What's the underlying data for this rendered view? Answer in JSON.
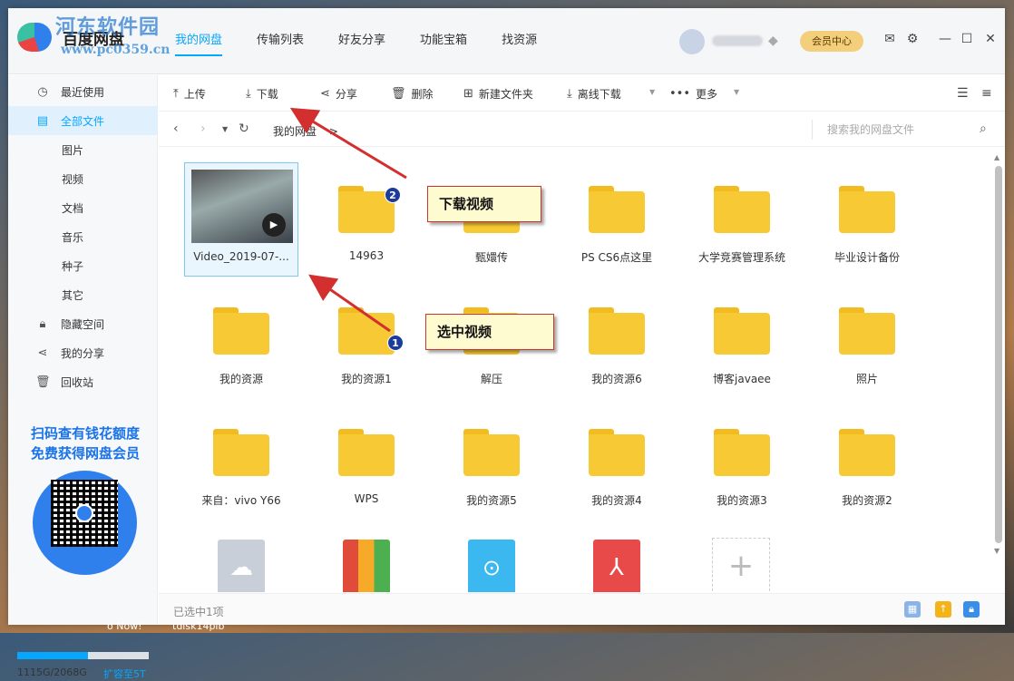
{
  "watermark": {
    "title": "河东软件园",
    "url": "www.pc0359.cn"
  },
  "header": {
    "app_name": "百度网盘",
    "nav": [
      "我的网盘",
      "传输列表",
      "好友分享",
      "功能宝箱",
      "找资源"
    ],
    "member_center": "会员中心"
  },
  "sidebar": {
    "items": [
      {
        "label": "最近使用",
        "icon": "clock-icon"
      },
      {
        "label": "全部文件",
        "icon": "document-icon"
      },
      {
        "label": "图片"
      },
      {
        "label": "视频"
      },
      {
        "label": "文档"
      },
      {
        "label": "音乐"
      },
      {
        "label": "种子"
      },
      {
        "label": "其它"
      },
      {
        "label": "隐藏空间",
        "icon": "lock-icon"
      },
      {
        "label": "我的分享",
        "icon": "share-icon"
      },
      {
        "label": "回收站",
        "icon": "trash-icon"
      }
    ],
    "promo_line1": "扫码查有钱花额度",
    "promo_line2": "免费获得网盘会员",
    "storage_text": "1115G/2068G",
    "storage_fraction": 0.54,
    "expand_label": "扩容至5T"
  },
  "toolbar": {
    "upload": "上传",
    "download": "下载",
    "share": "分享",
    "delete": "删除",
    "new_folder": "新建文件夹",
    "offline_download": "离线下载",
    "more": "更多"
  },
  "path": {
    "breadcrumb": "我的网盘",
    "separator": ">",
    "search_placeholder": "搜索我的网盘文件"
  },
  "files": [
    {
      "name": "Video_2019-07-...",
      "type": "video",
      "selected": true
    },
    {
      "name": "14963",
      "type": "folder"
    },
    {
      "name": "甄嬛传",
      "type": "folder"
    },
    {
      "name": "PS CS6点这里",
      "type": "folder"
    },
    {
      "name": "大学竞赛管理系统",
      "type": "folder"
    },
    {
      "name": "毕业设计备份",
      "type": "folder"
    },
    {
      "name": "我的资源",
      "type": "folder"
    },
    {
      "name": "我的资源1",
      "type": "folder"
    },
    {
      "name": "解压",
      "type": "folder"
    },
    {
      "name": "我的资源6",
      "type": "folder"
    },
    {
      "name": "博客javaee",
      "type": "folder"
    },
    {
      "name": "照片",
      "type": "folder"
    },
    {
      "name": "来自：vivo Y66",
      "type": "folder"
    },
    {
      "name": "WPS",
      "type": "folder"
    },
    {
      "name": "我的资源5",
      "type": "folder"
    },
    {
      "name": "我的资源4",
      "type": "folder"
    },
    {
      "name": "我的资源3",
      "type": "folder"
    },
    {
      "name": "我的资源2",
      "type": "folder"
    }
  ],
  "status": {
    "selected_text": "已选中1项"
  },
  "annotations": {
    "callout_download": "下载视频",
    "callout_select": "选中视频",
    "badge_1": "1",
    "badge_2": "2"
  },
  "desktop": {
    "taskbar_left": "o Now!",
    "taskbar_right": "tdisk14pib"
  },
  "colors": {
    "accent": "#06a7ff",
    "folder": "#f7c934",
    "member": "#f3cf7c",
    "annotation_arrow": "#d32f2f"
  }
}
